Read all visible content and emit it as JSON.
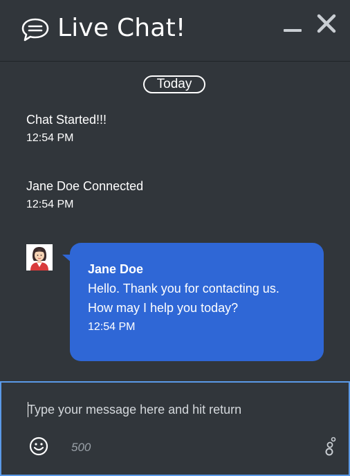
{
  "header": {
    "title": "Live Chat!",
    "icons": {
      "chat": "chat-bubble-icon",
      "minimize": "minimize-icon",
      "close": "close-icon"
    }
  },
  "conversation": {
    "date_label": "Today",
    "system_messages": [
      {
        "text": "Chat Started!!!",
        "time": "12:54 PM"
      },
      {
        "text": "Jane Doe Connected",
        "time": "12:54 PM"
      }
    ],
    "agent_message": {
      "sender": "Jane Doe",
      "line1": "Hello. Thank you for contacting us.",
      "line2": "How may I help you today?",
      "time": "12:54 PM"
    }
  },
  "composer": {
    "placeholder": "Type your message here and hit return",
    "value": "",
    "char_limit": "500",
    "icons": {
      "emoji": "smiley-icon",
      "extra": "bubbles-icon"
    }
  },
  "colors": {
    "background": "#31363b",
    "bubble": "#2f67d6",
    "input_border": "#5b9ae8"
  }
}
